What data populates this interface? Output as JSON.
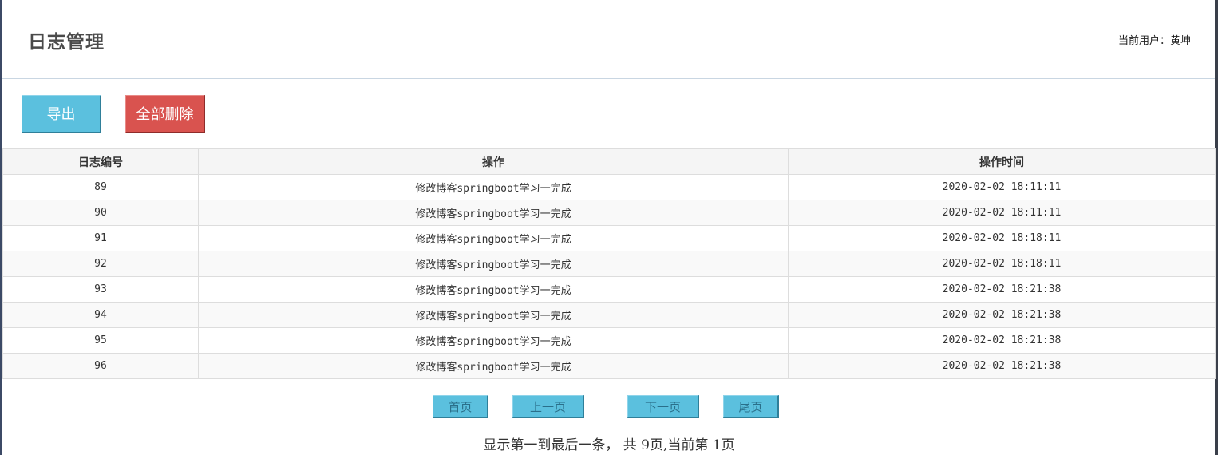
{
  "header": {
    "title": "日志管理",
    "current_user": "当前用户：黄坤"
  },
  "toolbar": {
    "export_label": "导出",
    "delete_all_label": "全部删除"
  },
  "table": {
    "columns": [
      "日志编号",
      "操作",
      "操作时间"
    ],
    "rows": [
      [
        "89",
        "修改博客springboot学习一完成",
        "2020-02-02 18:11:11"
      ],
      [
        "90",
        "修改博客springboot学习一完成",
        "2020-02-02 18:11:11"
      ],
      [
        "91",
        "修改博客springboot学习一完成",
        "2020-02-02 18:18:11"
      ],
      [
        "92",
        "修改博客springboot学习一完成",
        "2020-02-02 18:18:11"
      ],
      [
        "93",
        "修改博客springboot学习一完成",
        "2020-02-02 18:21:38"
      ],
      [
        "94",
        "修改博客springboot学习一完成",
        "2020-02-02 18:21:38"
      ],
      [
        "95",
        "修改博客springboot学习一完成",
        "2020-02-02 18:21:38"
      ],
      [
        "96",
        "修改博客springboot学习一完成",
        "2020-02-02 18:21:38"
      ]
    ]
  },
  "pagination": {
    "first_label": "首页",
    "prev_label": "上一页",
    "next_label": "下一页",
    "last_label": "尾页",
    "info": "显示第一到最后一条， 共 9页,当前第 1页"
  },
  "colors": {
    "info_button": "#5bc0de",
    "danger_button": "#d9534f"
  }
}
